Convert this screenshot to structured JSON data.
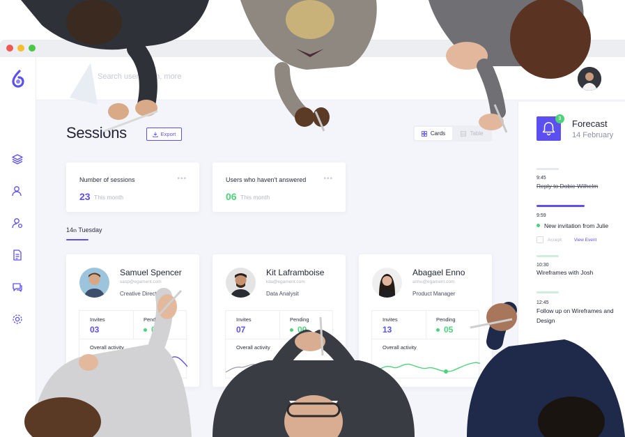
{
  "colors": {
    "accent": "#5b4ff0",
    "success": "#4cd37a",
    "background": "#f4f5fa",
    "card": "#ffffff"
  },
  "search": {
    "placeholder": "Search user, team, more"
  },
  "sidebar": {
    "icons": [
      "layers-icon",
      "users-icon",
      "user-settings-icon",
      "document-icon",
      "chat-icon",
      "settings-icon"
    ]
  },
  "header": {
    "title": "Sessions",
    "export_label": "Export",
    "view_toggle": {
      "cards_label": "Cards",
      "table_label": "Table",
      "selected": "Cards"
    }
  },
  "stats": [
    {
      "title": "Number of sessions",
      "value": "23",
      "sub": "This month",
      "color": "#5b4ff0"
    },
    {
      "title": "Users  who haven't answered",
      "value": "06",
      "sub": "This month",
      "color": "#4cd37a"
    }
  ],
  "date": {
    "day": "14",
    "suffix": "th",
    "weekday": "Tuesday"
  },
  "people": [
    {
      "name": "Samuel Spencer",
      "email": "sasp@egament.com",
      "role": "Creative Director",
      "invites_label": "Invites",
      "invites": "03",
      "pending_label": "Pending",
      "pending": "03",
      "activity_label": "Overall activity",
      "spark_color": "#5b4ff0"
    },
    {
      "name": "Kit Laframboise",
      "email": "kila@egament.com",
      "role": "Data Analysit",
      "invites_label": "Invites",
      "invites": "07",
      "pending_label": "Pending",
      "pending": "00",
      "activity_label": "Overall activity",
      "spark_color": "#9a9ca6"
    },
    {
      "name": "Abagael Enno",
      "email": "anhu@egament.com",
      "role": "Product Manager",
      "invites_label": "Invites",
      "invites": "13",
      "pending_label": "Pending",
      "pending": "05",
      "activity_label": "Overall activity",
      "spark_color": "#4cd37a"
    }
  ],
  "forecast": {
    "badge": "3",
    "title": "Forecast",
    "date": "14 February",
    "events": [
      {
        "time": "9:45",
        "text": "Reply to Dobie Wilhelm",
        "done": true,
        "bar_color": "#e6e8ee"
      },
      {
        "time": "9:59",
        "text": "New invitation from Julie",
        "done": false,
        "bar_color": "#5b4ff0",
        "accept_label": "Accept",
        "view_label": "View Event"
      },
      {
        "time": "10:30",
        "text": "Wireframes with Josh",
        "done": false,
        "bar_color": "#cfeedb"
      },
      {
        "time": "12:45",
        "text": "Follow up on Wireframes and Design",
        "done": false,
        "bar_color": "#cfeedb"
      }
    ]
  }
}
